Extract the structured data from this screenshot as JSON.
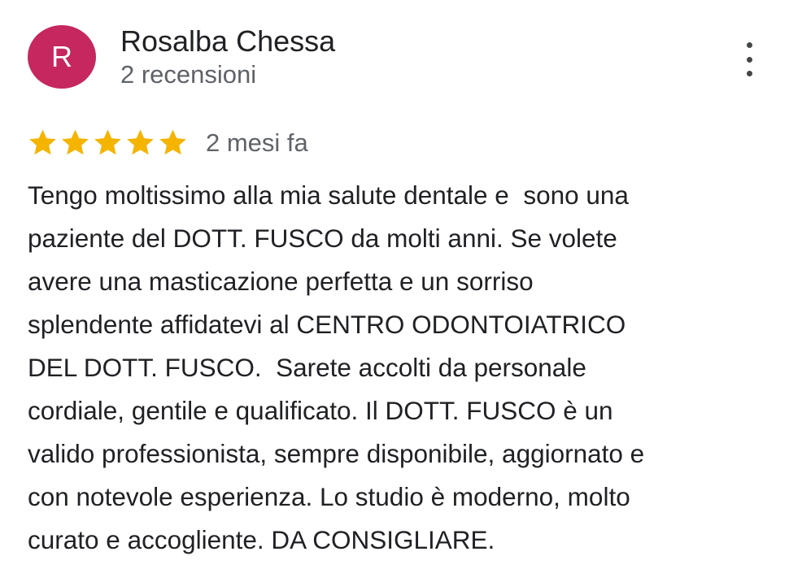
{
  "reviewer": {
    "avatar_initial": "R",
    "name": "Rosalba Chessa",
    "reviews_count": "2 recensioni"
  },
  "menu": {
    "icon": "more-vert-icon"
  },
  "rating": {
    "stars": 5,
    "max_stars": 5,
    "star_color": "#f4b400",
    "time": "2 mesi fa"
  },
  "review": {
    "lines": [
      "Tengo moltissimo alla mia salute dentale e  sono una",
      "paziente del DOTT. FUSCO da molti anni. Se volete",
      "avere una masticazione perfetta e un sorriso",
      "splendente affidatevi al CENTRO ODONTOIATRICO",
      "DEL DOTT. FUSCO.  Sarete accolti da personale",
      "cordiale, gentile e qualificato. Il DOTT. FUSCO è un",
      "valido professionista, sempre disponibile, aggiornato e",
      "con notevole esperienza. Lo studio è moderno, molto",
      "curato e accogliente. DA CONSIGLIARE."
    ]
  },
  "colors": {
    "avatar_bg": "#c5275e",
    "primary_text": "#202124",
    "secondary_text": "#5f6368"
  }
}
